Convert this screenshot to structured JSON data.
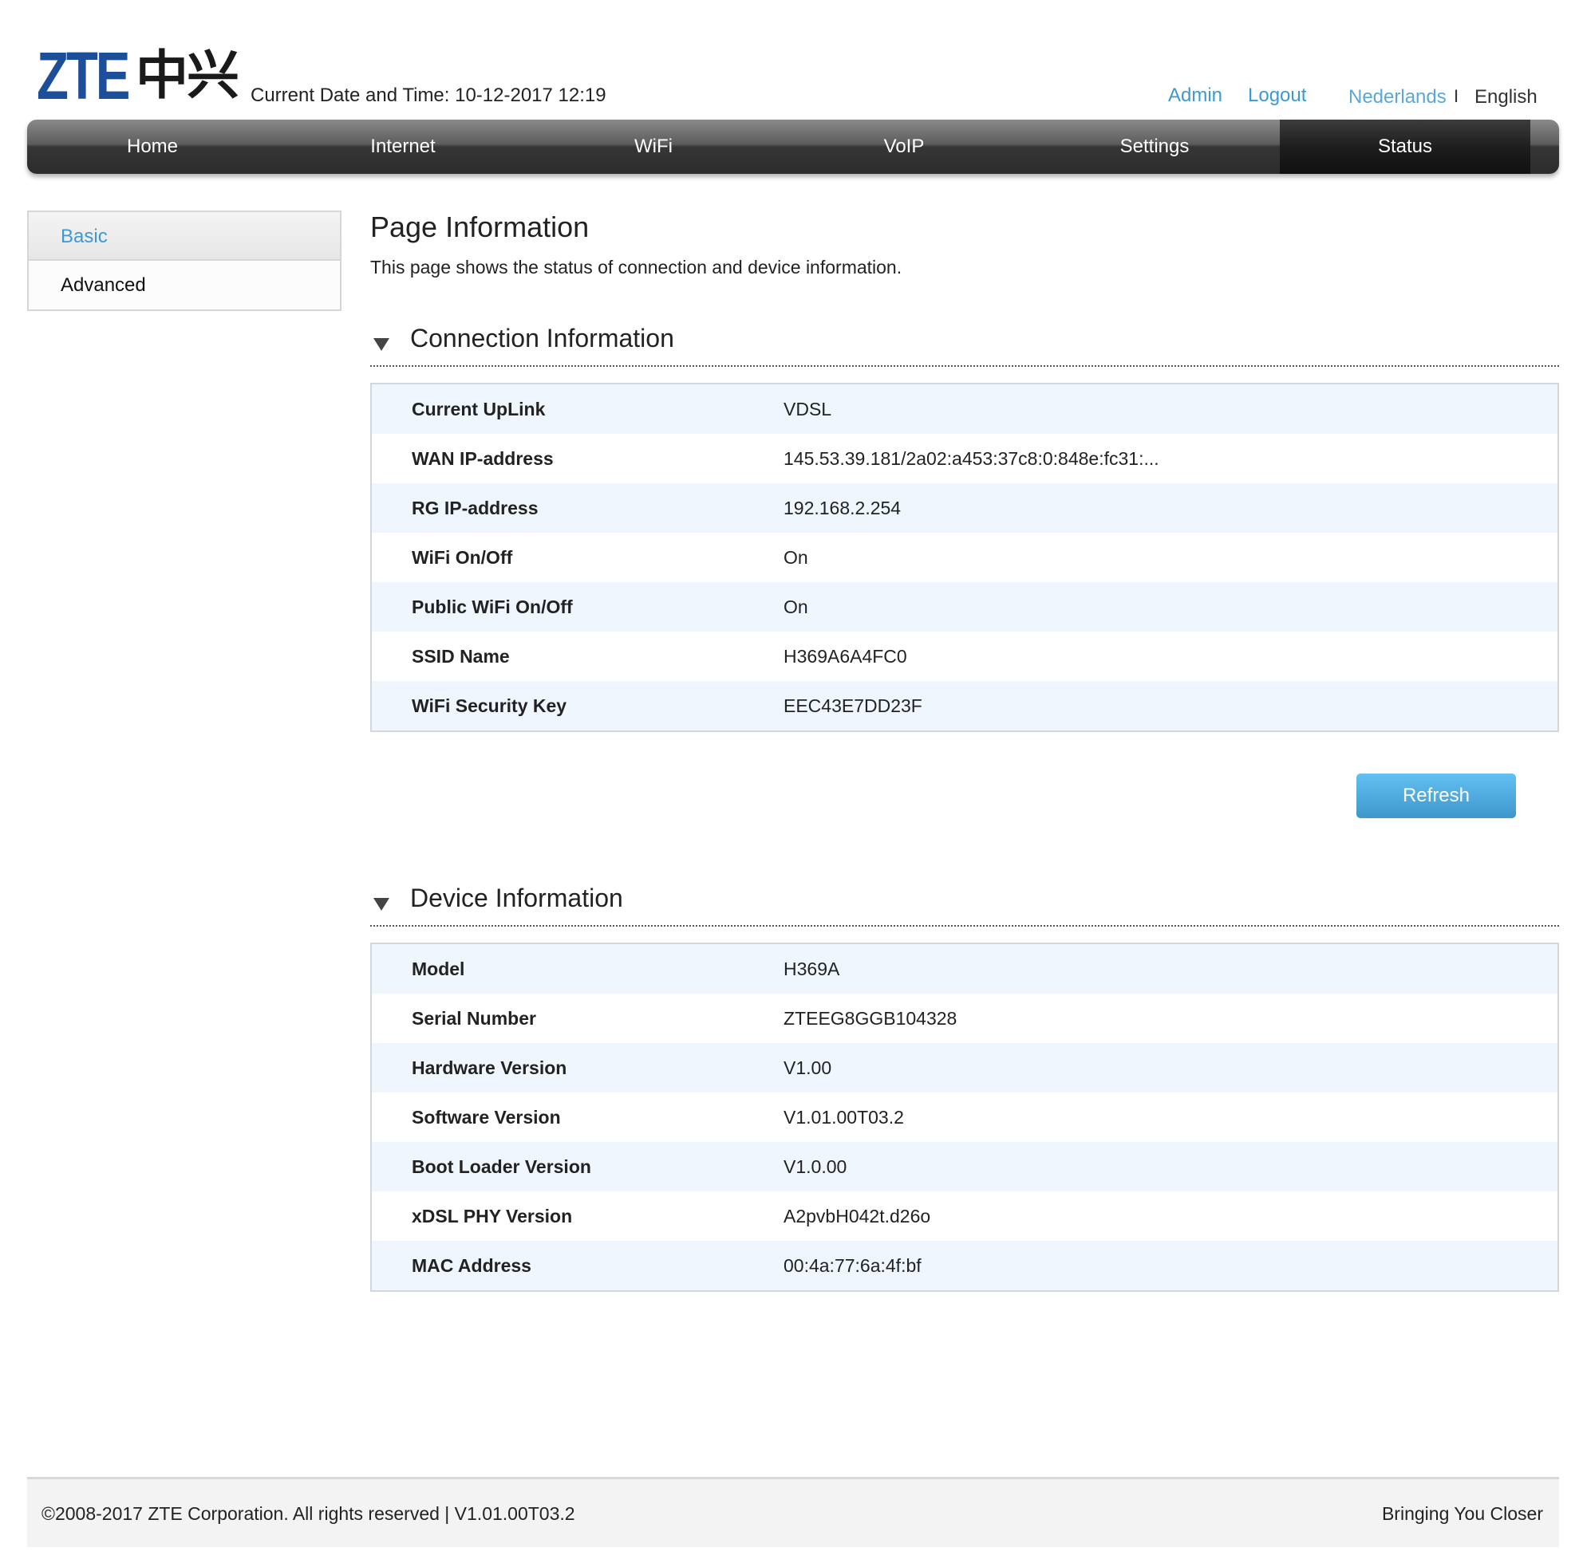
{
  "header": {
    "logo_latin": "ZTE",
    "logo_chinese": "中兴",
    "datetime_label": "Current Date and Time: 10-12-2017 12:19",
    "links": {
      "admin": "Admin",
      "logout": "Logout",
      "lang_nl": "Nederlands",
      "lang_sep": "I",
      "lang_en": "English"
    }
  },
  "nav": {
    "items": [
      {
        "label": "Home"
      },
      {
        "label": "Internet"
      },
      {
        "label": "WiFi"
      },
      {
        "label": "VoIP"
      },
      {
        "label": "Settings"
      },
      {
        "label": "Status",
        "active": true
      }
    ]
  },
  "sidebar": {
    "items": [
      {
        "label": "Basic",
        "active": true
      },
      {
        "label": "Advanced"
      }
    ]
  },
  "main": {
    "title": "Page Information",
    "description": "This page shows the status of connection and device information.",
    "connection": {
      "title": "Connection Information",
      "rows": [
        {
          "label": "Current UpLink",
          "value": "VDSL"
        },
        {
          "label": "WAN IP-address",
          "value": "145.53.39.181/2a02:a453:37c8:0:848e:fc31:..."
        },
        {
          "label": "RG IP-address",
          "value": "192.168.2.254"
        },
        {
          "label": "WiFi On/Off",
          "value": "On"
        },
        {
          "label": "Public WiFi On/Off",
          "value": "On"
        },
        {
          "label": "SSID Name",
          "value": "H369A6A4FC0"
        },
        {
          "label": "WiFi Security Key",
          "value": "EEC43E7DD23F"
        }
      ]
    },
    "refresh_label": "Refresh",
    "device": {
      "title": "Device Information",
      "rows": [
        {
          "label": "Model",
          "value": "H369A"
        },
        {
          "label": "Serial Number",
          "value": "ZTEEG8GGB104328"
        },
        {
          "label": "Hardware Version",
          "value": "V1.00"
        },
        {
          "label": "Software Version",
          "value": "V1.01.00T03.2"
        },
        {
          "label": "Boot Loader Version",
          "value": "V1.0.00"
        },
        {
          "label": "xDSL PHY Version",
          "value": "A2pvbH042t.d26o"
        },
        {
          "label": "MAC Address",
          "value": "00:4a:77:6a:4f:bf"
        }
      ]
    }
  },
  "footer": {
    "copyright": "©2008-2017 ZTE Corporation. All rights reserved  |   V1.01.00T03.2",
    "slogan": "Bringing You Closer"
  },
  "colors": {
    "brand_blue": "#1c4e9a",
    "link_blue": "#3c9ad0",
    "row_highlight": "#eff6fd",
    "button_top": "#62c0f3",
    "button_bottom": "#3f97cb"
  }
}
